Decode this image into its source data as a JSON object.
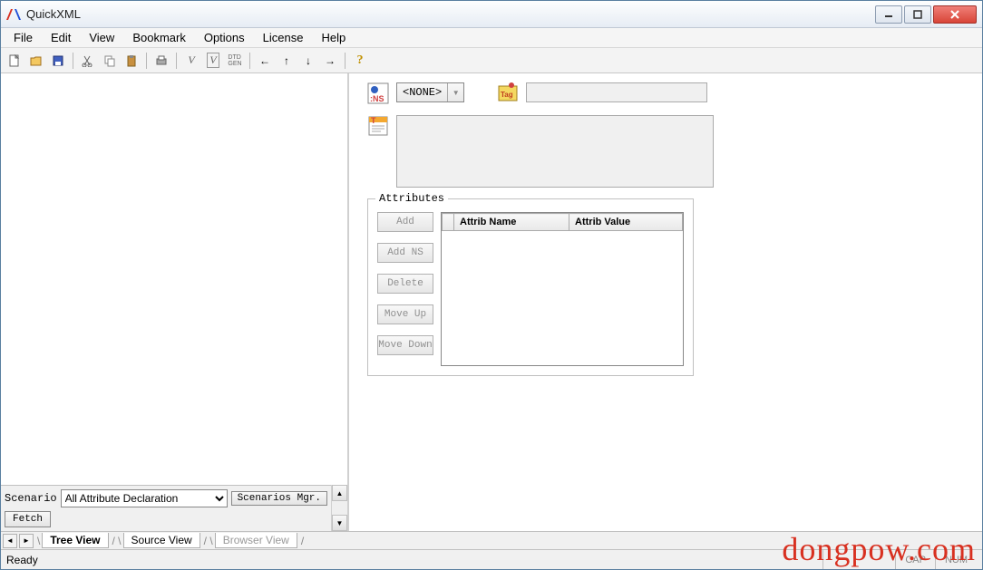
{
  "window": {
    "title": "QuickXML"
  },
  "menu": [
    "File",
    "Edit",
    "View",
    "Bookmark",
    "Options",
    "License",
    "Help"
  ],
  "toolbar_icons": [
    "new",
    "open",
    "save",
    "cut",
    "copy",
    "paste",
    "print",
    "validate-v",
    "validate-v2",
    "dtd-gen",
    "arrow-left",
    "arrow-right",
    "arrow-down",
    "arrow-up",
    "help"
  ],
  "right_panel": {
    "ns_value": "<NONE>",
    "attributes_legend": "Attributes",
    "attrib_buttons": [
      "Add",
      "Add NS",
      "Delete",
      "Move Up",
      "Move Down"
    ],
    "attrib_columns": [
      "",
      "Attrib Name",
      "Attrib Value"
    ]
  },
  "scenario": {
    "label": "Scenario",
    "selected": "All Attribute Declaration",
    "mgr_button": "Scenarios Mgr.",
    "fetch_button": "Fetch"
  },
  "tabs": {
    "items": [
      "Tree View",
      "Source View",
      "Browser View"
    ],
    "active": 0
  },
  "status": {
    "text": "Ready",
    "cap": "CAP",
    "num": "NUM"
  },
  "watermark": "dongpow.com"
}
